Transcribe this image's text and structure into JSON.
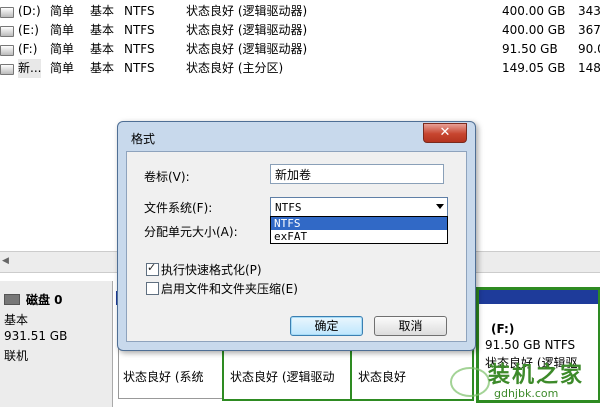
{
  "volumes": [
    {
      "name": "(D:)",
      "layout": "简单",
      "type": "基本",
      "fs": "NTFS",
      "status": "状态良好 (逻辑驱动器)",
      "capacity": "400.00 GB",
      "free": "343"
    },
    {
      "name": "(E:)",
      "layout": "简单",
      "type": "基本",
      "fs": "NTFS",
      "status": "状态良好 (逻辑驱动器)",
      "capacity": "400.00 GB",
      "free": "367"
    },
    {
      "name": "(F:)",
      "layout": "简单",
      "type": "基本",
      "fs": "NTFS",
      "status": "状态良好 (逻辑驱动器)",
      "capacity": "91.50 GB",
      "free": "90.0"
    },
    {
      "name": "新...",
      "layout": "简单",
      "type": "基本",
      "fs": "NTFS",
      "status": "状态良好 (主分区)",
      "capacity": "149.05 GB",
      "free": "148"
    }
  ],
  "disk": {
    "name": "磁盘 0",
    "type": "基本",
    "size": "931.51 GB",
    "state": "联机"
  },
  "partitions": {
    "p1_status": "状态良好 (系统",
    "p2_status": "状态良好 (逻辑驱动",
    "p3_status": "状态良好",
    "selected": {
      "letter": "(F:)",
      "detail": "91.50 GB NTFS",
      "status": "状态良好 (逻辑驱"
    }
  },
  "dialog": {
    "title": "格式",
    "close_glyph": "✕",
    "volume_label_caption": "卷标(V):",
    "volume_label_value": "新加卷",
    "filesystem_caption": "文件系统(F):",
    "filesystem_value": "NTFS",
    "filesystem_options": [
      "NTFS",
      "exFAT"
    ],
    "alloc_caption": "分配单元大小(A):",
    "quick_format_label": "执行快速格式化(P)",
    "quick_format_checked": true,
    "compression_label": "启用文件和文件夹压缩(E)",
    "compression_checked": false,
    "ok_label": "确定",
    "cancel_label": "取消"
  },
  "watermark": {
    "text": "装机之家",
    "url": "gdhjbk.com"
  },
  "colors": {
    "partition_bar": "#1e3b9a",
    "selected_border": "#2e8b22",
    "dropdown_highlight": "#3169c6"
  }
}
